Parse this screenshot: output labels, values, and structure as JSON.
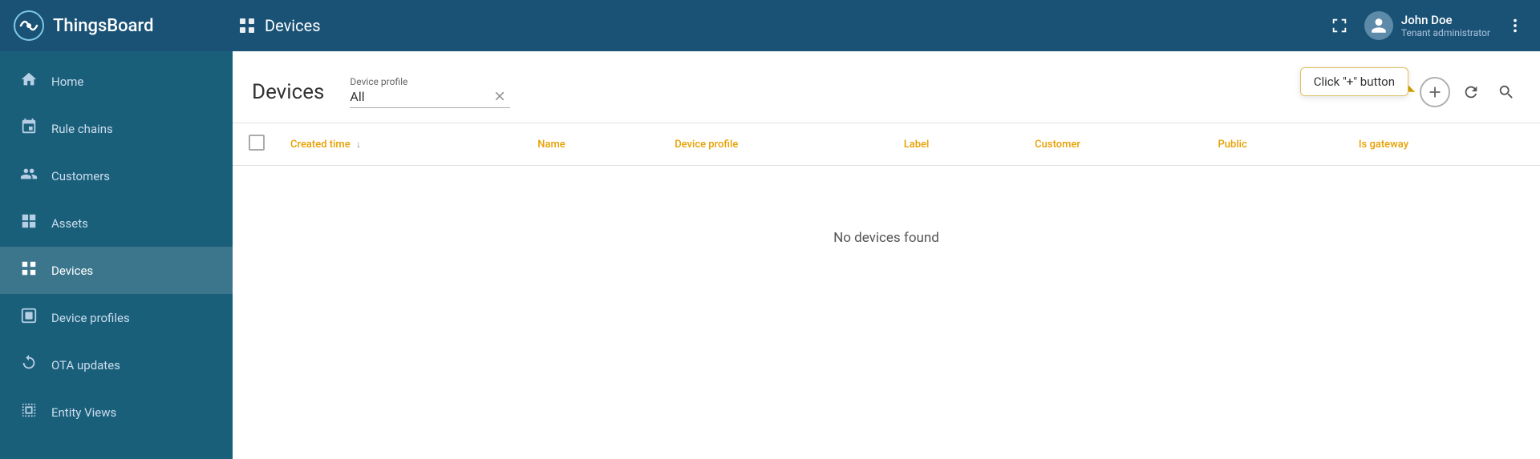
{
  "topbar": {
    "logo_text": "ThingsBoard",
    "page_title": "Devices",
    "fullscreen_label": "Fullscreen",
    "user_name": "John Doe",
    "user_role": "Tenant administrator",
    "more_label": "More options"
  },
  "sidebar": {
    "items": [
      {
        "id": "home",
        "label": "Home",
        "icon": "⌂",
        "active": false
      },
      {
        "id": "rule-chains",
        "label": "Rule chains",
        "icon": "⇄",
        "active": false
      },
      {
        "id": "customers",
        "label": "Customers",
        "icon": "👤",
        "active": false
      },
      {
        "id": "assets",
        "label": "Assets",
        "icon": "⊞",
        "active": false
      },
      {
        "id": "devices",
        "label": "Devices",
        "icon": "▦",
        "active": true
      },
      {
        "id": "device-profiles",
        "label": "Device profiles",
        "icon": "▣",
        "active": false
      },
      {
        "id": "ota-updates",
        "label": "OTA updates",
        "icon": "⟳",
        "active": false
      },
      {
        "id": "entity-views",
        "label": "Entity Views",
        "icon": "⊟",
        "active": false
      }
    ]
  },
  "main": {
    "page_title": "Devices",
    "filter_label": "Device profile",
    "filter_value": "All",
    "table": {
      "columns": [
        {
          "id": "created_time",
          "label": "Created time",
          "sortable": true
        },
        {
          "id": "name",
          "label": "Name",
          "sortable": false
        },
        {
          "id": "device_profile",
          "label": "Device profile",
          "sortable": false
        },
        {
          "id": "label",
          "label": "Label",
          "sortable": false
        },
        {
          "id": "customer",
          "label": "Customer",
          "sortable": false
        },
        {
          "id": "public",
          "label": "Public",
          "sortable": false
        },
        {
          "id": "is_gateway",
          "label": "Is gateway",
          "sortable": false
        }
      ],
      "empty_message": "No devices found"
    },
    "tooltip": {
      "text": "Click \"+\" button"
    }
  }
}
